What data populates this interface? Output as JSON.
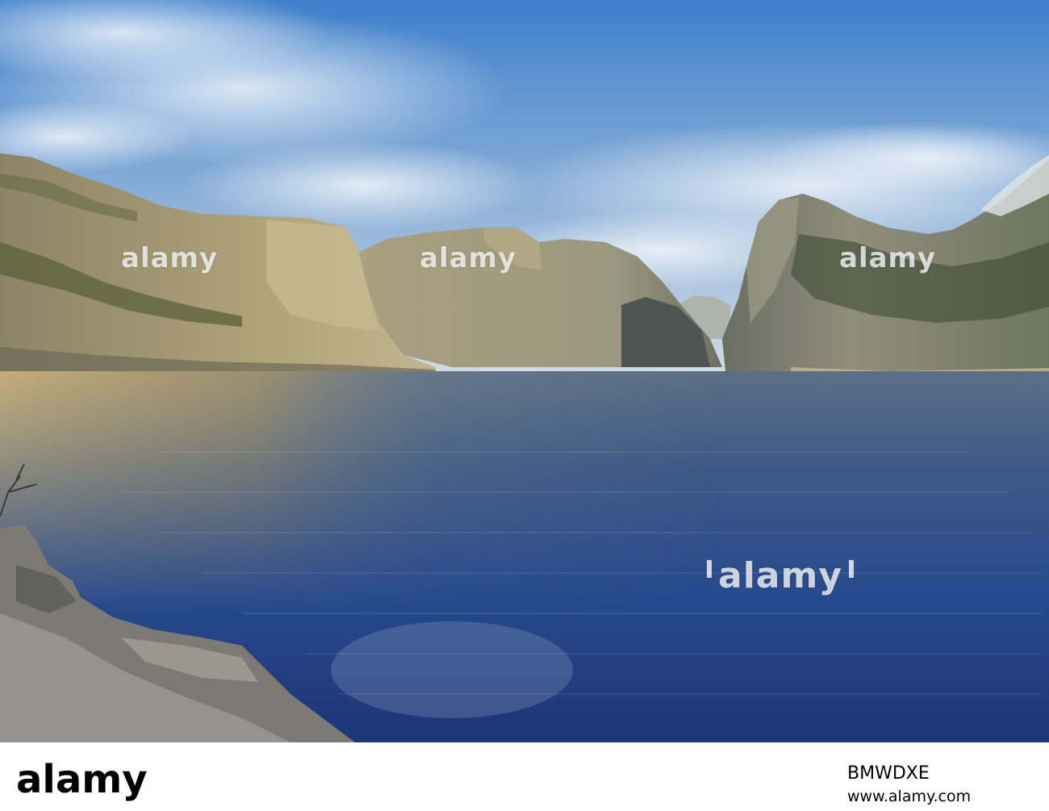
{
  "watermark": {
    "text": "alamy"
  },
  "footer": {
    "logo_text": "alamy",
    "image_id": "BMWDXE",
    "url": "www.alamy.com"
  },
  "colors": {
    "sky_top": "#4a86cc",
    "sky_bottom": "#c9d8e6",
    "water_deep": "#1f3f86",
    "water_reflection_warm": "#b39d6c",
    "cliff_sunlit": "#a69a78",
    "cliff_shadow": "#5e6258",
    "vegetation": "#4f5a34"
  }
}
